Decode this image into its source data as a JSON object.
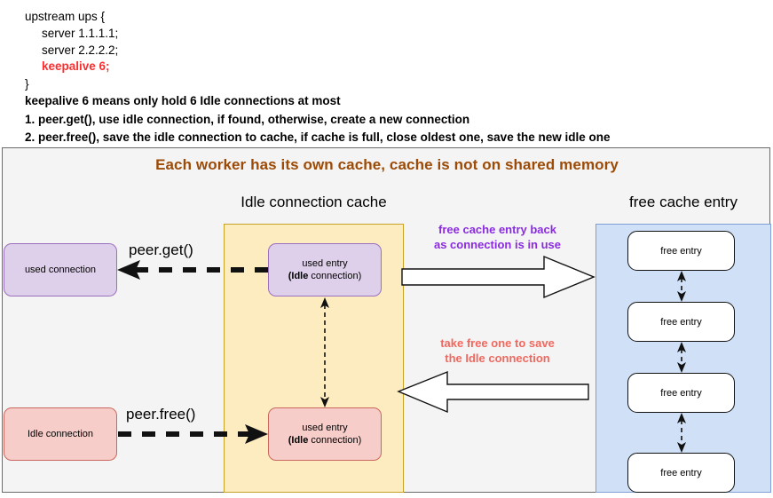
{
  "notes": {
    "code": [
      {
        "text": "upstream ups {",
        "indent": false,
        "keyword": false
      },
      {
        "text": "server 1.1.1.1;",
        "indent": true,
        "keyword": false
      },
      {
        "text": "server 2.2.2.2;",
        "indent": true,
        "keyword": false
      },
      {
        "text": "keepalive 6;",
        "indent": true,
        "keyword": true
      },
      {
        "text": "}",
        "indent": false,
        "keyword": false
      }
    ],
    "lines": [
      "keepalive 6 means only hold 6 Idle connections at most",
      "1. peer.get(), use idle connection, if found, otherwise, create a new connection",
      "2. peer.free(), save the idle connection to cache, if cache is full, close oldest one, save the new idle one"
    ]
  },
  "diagram": {
    "banner": "Each worker has its own cache, cache is not on shared memory",
    "cache_panel_title": "Idle connection cache",
    "free_panel_title": "free cache entry",
    "used_connection": "used connection",
    "idle_connection": "Idle connection",
    "used_entry_top": {
      "line1": "used entry",
      "line2_bold": "(Idle",
      "line2_rest": " connection)"
    },
    "used_entry_bottom": {
      "line1": "used entry",
      "line2_bold": "(Idle",
      "line2_rest": " connection)"
    },
    "peer_get_label": "peer.get()",
    "peer_free_label": "peer.free()",
    "annotation_free_back": {
      "line1": "free cache entry back",
      "line2": "as connection is in use"
    },
    "annotation_take_free": {
      "line1": "take free one to save",
      "line2": "the Idle connection"
    },
    "free_entries": [
      "free entry",
      "free entry",
      "free entry",
      "free entry"
    ],
    "colors": {
      "banner": "#9c4a06",
      "cache_panel": "#fdecbf",
      "free_panel": "#cfe0f7",
      "purple_node": "#ded0ea",
      "red_node": "#f7cdc9",
      "annotation_purple": "#8a2be2",
      "annotation_red": "#f1685e",
      "keyword_red": "#ff2d2d"
    }
  }
}
